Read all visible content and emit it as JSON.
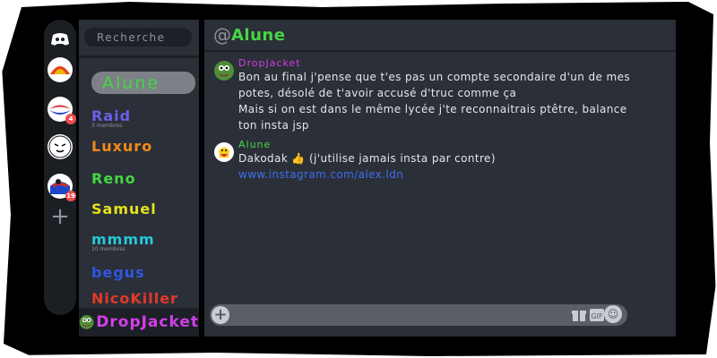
{
  "search": {
    "placeholder": "Recherche"
  },
  "friends": [
    {
      "name": "Alune",
      "color": "#44d744",
      "active": true
    },
    {
      "name": "Raid",
      "color": "#6c5ee8",
      "sub": "3 membres"
    },
    {
      "name": "Luxuro",
      "color": "#f28a1c"
    },
    {
      "name": "Reno",
      "color": "#44d744"
    },
    {
      "name": "Samuel",
      "color": "#e7e11d"
    },
    {
      "name": "mmmm",
      "color": "#27c7d8",
      "sub": "10 membres"
    },
    {
      "name": "begus",
      "color": "#2f56e0"
    },
    {
      "name": "NicoKiller",
      "color": "#e23a2a"
    }
  ],
  "me": {
    "name": "DropJacket"
  },
  "chat": {
    "title": "Alune",
    "messages": [
      {
        "author": "DropJacket",
        "author_color": "#d33ee9",
        "lines": [
          "Bon au final j'pense que t'es pas un compte secondaire d'un de mes",
          "potes, désolé de t'avoir accusé d'truc comme ça",
          "Mais si on est dans le même lycée j'te reconnaitrais ptêtre, balance",
          "ton insta jsp"
        ]
      },
      {
        "author": "Alune",
        "author_color": "#44d744",
        "text": "Dakodak 👍 (j'utilise jamais insta par contre)",
        "link": "www.instagram.com/alex.ldn"
      }
    ]
  },
  "servers": [
    {
      "icon": "discord-icon"
    },
    {
      "icon": "server-1-icon"
    },
    {
      "icon": "server-2-icon",
      "badge": "4"
    },
    {
      "icon": "server-3-icon"
    },
    {
      "icon": "server-4-icon",
      "badge": "19"
    },
    {
      "icon": "add-server-icon"
    }
  ]
}
